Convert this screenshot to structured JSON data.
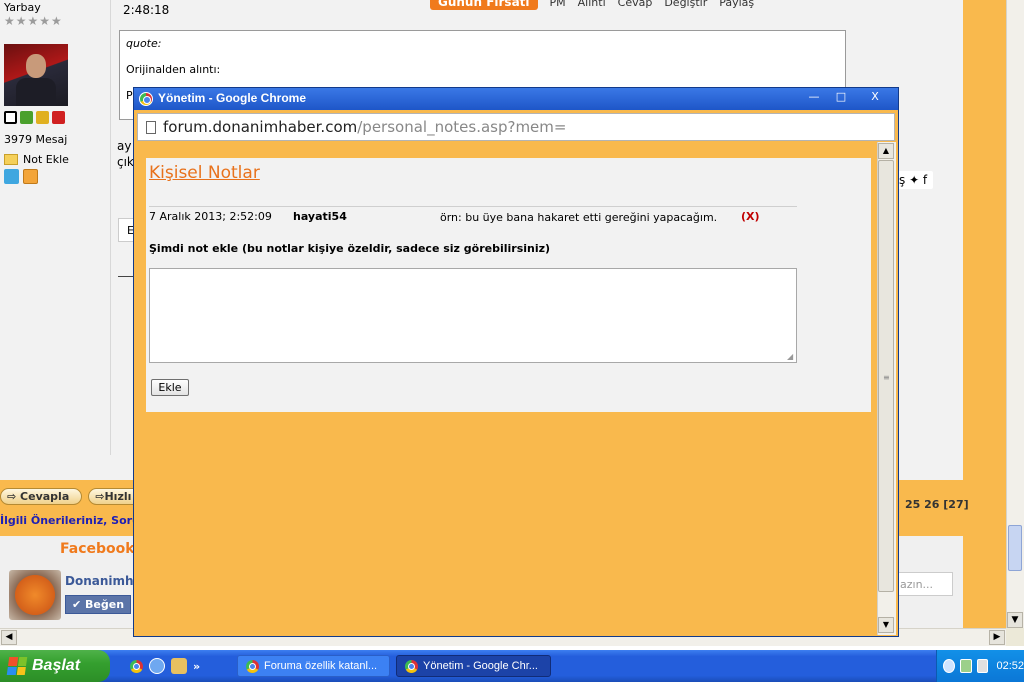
{
  "background_page": {
    "user": {
      "rank": "Yarbay",
      "stars": "★★★★★",
      "message_count": "3979 Mesaj",
      "note_add_label": "Not Ekle",
      "status_colors": [
        "#000000",
        "#4aa02c",
        "#e0b020",
        "#d02020"
      ]
    },
    "post": {
      "time": "2:48:18",
      "deal_label": "Günün Fırsatı",
      "toolbar": [
        "PM",
        "Alıntı",
        "Cevap",
        "Değiştir",
        "Paylaş"
      ],
      "quote_label": "quote:",
      "quote_source": "Orijinalden alıntı:",
      "quote_fragment": "P",
      "body_fragment_1": "ay",
      "body_fragment_2": "çık",
      "share_icons": "ş  ✦  f",
      "small_box_text": "E"
    },
    "reply_buttons": [
      "Cevapla",
      "Hızlı"
    ],
    "pagination": "25 26 [27]",
    "suggestions_line": "İlgili Önerileriniz, Sorun",
    "facebook": {
      "title": "Facebook",
      "page_name": "Donanimha",
      "like_label": "Beğen",
      "comment_placeholder": "azın..."
    }
  },
  "popup": {
    "title": "Yönetim - Google Chrome",
    "url_host": "forum.donanimhaber.com",
    "url_path": "/personal_notes.asp?mem=",
    "heading": "Kişisel Notlar",
    "notes": [
      {
        "date": "7 Aralık 2013; 2:52:09",
        "user": "hayati54",
        "text": "örn: bu üye bana hakaret etti gereğini yapacağım.",
        "delete_label": "(X)"
      }
    ],
    "add_label": "Şimdi not ekle (bu notlar kişiye özeldir, sadece siz görebilirsiniz)",
    "note_input_value": "",
    "add_button": "Ekle",
    "window_buttons": {
      "minimize": "—",
      "maximize": "□",
      "close": "X"
    }
  },
  "taskbar": {
    "start_label": "Başlat",
    "tasks": [
      {
        "label": "Foruma özellik katanl...",
        "active": false
      },
      {
        "label": "Yönetim - Google Chr...",
        "active": true
      }
    ],
    "quicklaunch_more": "»",
    "clock": "02:52"
  },
  "colors": {
    "page_accent": "#f9b94d",
    "title_orange": "#e8721c",
    "delete_red": "#c00000",
    "xp_blue": "#245edc",
    "start_green": "#35a02f"
  },
  "icons": [
    "chrome-icon",
    "page-icon",
    "folder-icon",
    "twitter-icon",
    "home-icon",
    "windows-logo-icon",
    "clock-tray-icon"
  ]
}
